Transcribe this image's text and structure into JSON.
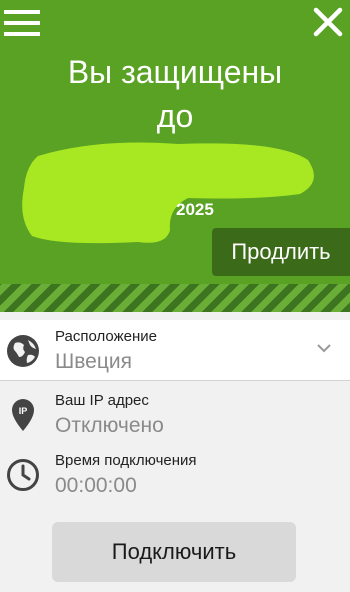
{
  "header": {
    "title": "Вы защищены",
    "until": "до",
    "year": "2025",
    "renew_label": "Продлить",
    "menu_icon": "hamburger-menu-icon",
    "close_icon": "close-icon"
  },
  "colors": {
    "accent_green": "#5aa224",
    "redaction": "#a7e823",
    "renew_bg": "#3b6a18"
  },
  "location": {
    "label": "Расположение",
    "value": "Швеция",
    "icon": "globe-icon"
  },
  "ip": {
    "label": "Ваш IP адрес",
    "value": "Отключено",
    "icon": "ip-pin-icon",
    "badge": "IP"
  },
  "connection_time": {
    "label": "Время подключения",
    "value": "00:00:00",
    "icon": "clock-icon"
  },
  "connect_button": {
    "label": "Подключить"
  }
}
